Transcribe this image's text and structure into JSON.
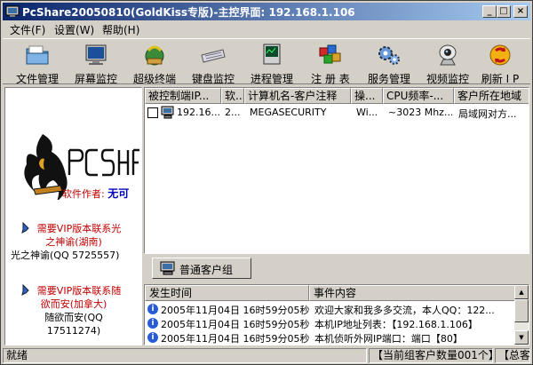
{
  "window": {
    "title": "PcShare20050810(GoldKiss专版)-主控界面: 192.168.1.106",
    "min_label": "_",
    "max_label": "□",
    "close_label": "×"
  },
  "menu": {
    "items": [
      "文件(F)",
      "设置(W)",
      "帮助(H)"
    ]
  },
  "toolbar": {
    "items": [
      {
        "label": "文件管理",
        "icon": "folder-icon"
      },
      {
        "label": "屏幕监控",
        "icon": "monitor-icon"
      },
      {
        "label": "超级终端",
        "icon": "terminal-icon"
      },
      {
        "label": "键盘监控",
        "icon": "keyboard-icon"
      },
      {
        "label": "进程管理",
        "icon": "process-icon"
      },
      {
        "label": "注 册 表",
        "icon": "registry-icon"
      },
      {
        "label": "服务管理",
        "icon": "gears-icon"
      },
      {
        "label": "视频监控",
        "icon": "camera-icon"
      },
      {
        "label": "刷新 I P",
        "icon": "refresh-icon"
      }
    ]
  },
  "left": {
    "logo_text": "PC SHARE",
    "author_label": "软件作者:",
    "author_name": "无可",
    "vip1_line1": "需要VIP版本联系光",
    "vip1_line2": "之神谕(湖南)",
    "vip1_contact": "光之神谕(QQ 5725557)",
    "vip2_line1": "需要VIP版本联系随",
    "vip2_line2": "欲而安(加拿大)",
    "vip2_contact1": "随欲而安(QQ",
    "vip2_contact2": "17511274)"
  },
  "hosts": {
    "columns": [
      "被控制端IP...",
      "软...",
      "计算机名-客户注释",
      "操...",
      "CPU频率-...",
      "客户所在地域"
    ],
    "rows": [
      {
        "ip": "192.16...",
        "ver": "2...",
        "name": "MEGASECURITY",
        "os": "Wi...",
        "cpu": "~3023 Mhz...",
        "region": "局域网对方..."
      }
    ]
  },
  "group": {
    "tab_label": "普通客户组"
  },
  "events": {
    "columns": [
      "发生时间",
      "事件内容"
    ],
    "rows": [
      {
        "time": "2005年11月04日 16时59分05秒",
        "msg": "欢迎大家和我多多交流，本人QQ：122..."
      },
      {
        "time": "2005年11月04日 16时59分05秒",
        "msg": "本机IP地址列表：【192.168.1.106】"
      },
      {
        "time": "2005年11月04日 16时59分05秒",
        "msg": "本机侦听外网IP端口：端口【80】"
      }
    ]
  },
  "status": {
    "left": "就绪",
    "count": "【当前组客户数量001个】",
    "total": "【总客"
  }
}
